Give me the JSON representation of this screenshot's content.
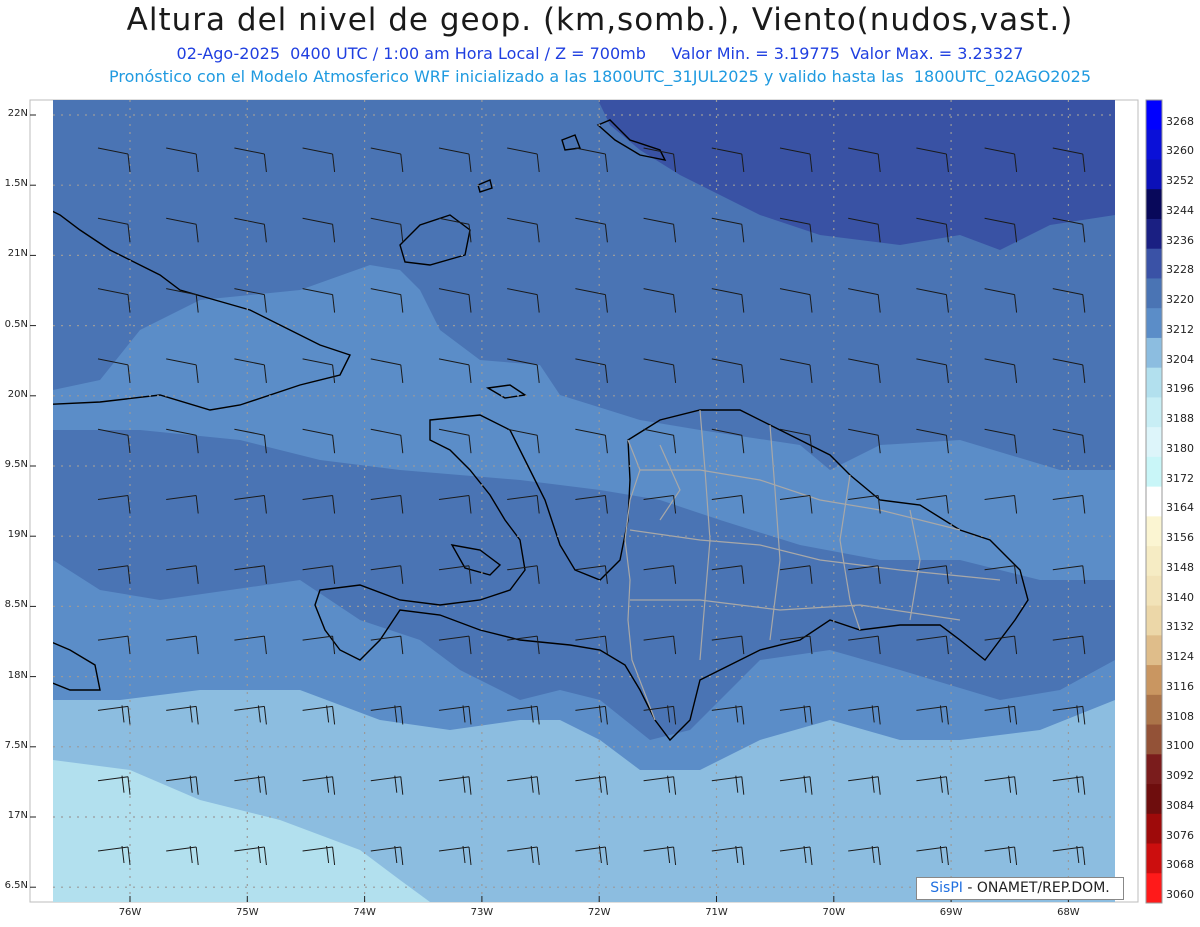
{
  "header": {
    "title": "Altura del nivel de geop. (km,somb.), Viento(nudos,vast.)",
    "subtitle1": "02-Ago-2025  0400 UTC / 1:00 am Hora Local / Z = 700mb     Valor Min. = 3.19775  Valor Max. = 3.23327",
    "subtitle2": "Pronóstico con el Modelo Atmosferico WRF inicializado a las 1800UTC_31JUL2025 y valido hasta las  1800UTC_02AGO2025"
  },
  "credit": {
    "brand": "SisPI",
    "text": " - ONAMET/REP.DOM."
  },
  "map": {
    "lat_labels": [
      "22N",
      "1.5N",
      "21N",
      "0.5N",
      "20N",
      "9.5N",
      "19N",
      "8.5N",
      "18N",
      "7.5N",
      "17N",
      "6.5N"
    ],
    "lon_labels": [
      "76W",
      "75W",
      "74W",
      "73W",
      "72W",
      "71W",
      "70W",
      "69W",
      "68W"
    ],
    "colorbar_labels": [
      "3268",
      "3260",
      "3252",
      "3244",
      "3236",
      "3228",
      "3220",
      "3212",
      "3204",
      "3196",
      "3188",
      "3180",
      "3172",
      "3164",
      "3156",
      "3148",
      "3140",
      "3132",
      "3124",
      "3116",
      "3108",
      "3100",
      "3092",
      "3084",
      "3076",
      "3068",
      "3060"
    ],
    "colorbar_colors": [
      "#0000ff",
      "#0a10d8",
      "#0b10b8",
      "#08085a",
      "#1a1f82",
      "#3a52a6",
      "#4a74b4",
      "#5b8dc8",
      "#8cbde0",
      "#b2e0ee",
      "#c8eef5",
      "#ddf5fa",
      "#c9f6f8",
      "#ffffff",
      "#fbf5d2",
      "#f6ecc4",
      "#f2e3b8",
      "#ecd7a8",
      "#dfbd8a",
      "#c99661",
      "#ab7449",
      "#935237",
      "#7a1c1c",
      "#6e0d0d",
      "#9e0a0a",
      "#cc0e0e",
      "#ff1a1a"
    ],
    "field_colors": {
      "dark": "#3952a4",
      "mid": "#4a74b4",
      "light": "#5b8dc8",
      "lighter": "#8cbde0",
      "palest": "#b2e0ee"
    }
  }
}
